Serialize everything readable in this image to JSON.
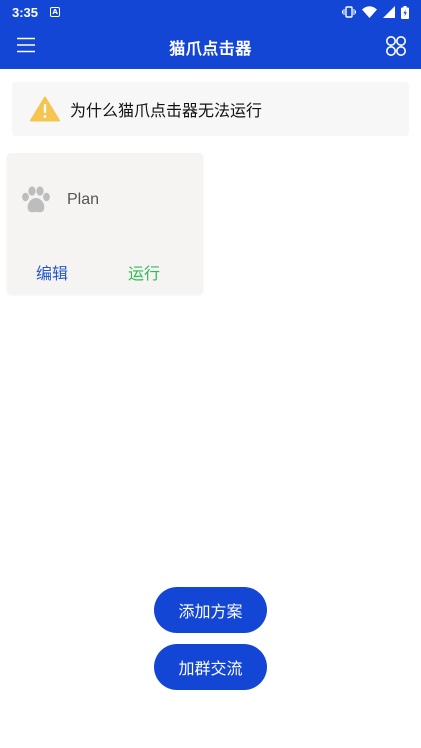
{
  "status_bar": {
    "time": "3:35",
    "notif_glyph": "A"
  },
  "app_bar": {
    "title": "猫爪点击器",
    "menu_icon": "hamburger-menu-icon",
    "grid_icon": "command-grid-icon"
  },
  "warning": {
    "text": "为什么猫爪点击器无法运行",
    "icon": "warning-triangle-icon"
  },
  "plans": [
    {
      "name": "Plan",
      "icon": "paw-icon",
      "edit_label": "编辑",
      "run_label": "运行"
    }
  ],
  "buttons": {
    "add_plan": "添加方案",
    "join_group": "加群交流"
  },
  "colors": {
    "primary": "#1446d6",
    "edit": "#2458c9",
    "run": "#2fbd52",
    "warning": "#f5c451"
  }
}
